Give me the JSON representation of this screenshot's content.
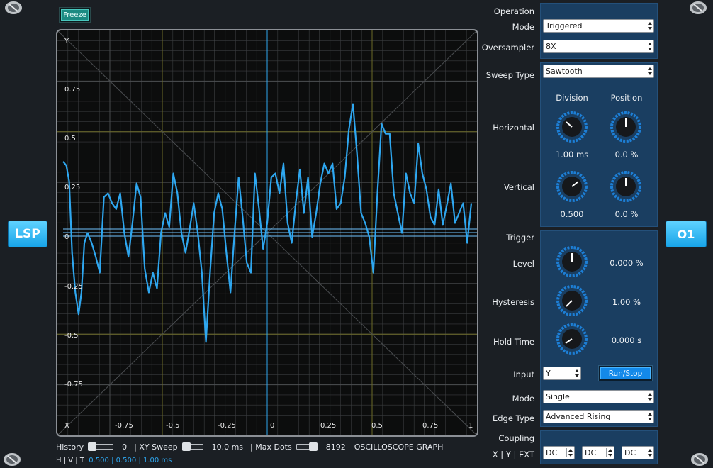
{
  "left_button": "LSP",
  "right_button": "O1",
  "freeze_label": "Freeze",
  "graph": {
    "y_axis_label": "Y",
    "x_axis_label": "X",
    "y_ticks": [
      "0.75",
      "0.5",
      "0.25",
      "0",
      "-0.25",
      "-0.5",
      "-0.75"
    ],
    "x_ticks": [
      "-0.75",
      "-0.5",
      "-0.25",
      "0",
      "0.25",
      "0.5",
      "0.75",
      "1"
    ],
    "colors": {
      "trace": "#2ea7f0",
      "grid": "#3a3d3f",
      "major_grid": "#6b6a26",
      "center": "#2ea7f0"
    }
  },
  "bottom": {
    "history_label": "History",
    "history_value": "0",
    "xy_sweep_label": "| XY Sweep",
    "xy_sweep_value": "10.0 ms",
    "max_dots_label": "| Max Dots",
    "max_dots_value": "8192",
    "graph_title": "OSCILLOSCOPE GRAPH",
    "hvt_label": "H | V | T",
    "hvt_values": "0.500 | 0.500 |  1.00 ms"
  },
  "operation": {
    "section_label": "Operation",
    "mode_label": "Mode",
    "mode_value": "Triggered",
    "oversampler_label": "Oversampler",
    "oversampler_value": "8X"
  },
  "sweep": {
    "sweep_type_label": "Sweep Type",
    "sweep_type_value": "Sawtooth",
    "division_label": "Division",
    "position_label": "Position",
    "horizontal_label": "Horizontal",
    "h_division_value": "1.00 ms",
    "h_position_value": "0.0 %",
    "vertical_label": "Vertical",
    "v_division_value": "0.500",
    "v_position_value": "0.0 %"
  },
  "trigger": {
    "section_label": "Trigger",
    "level_label": "Level",
    "level_value": "0.000 %",
    "hysteresis_label": "Hysteresis",
    "hysteresis_value": "1.00 %",
    "hold_time_label": "Hold Time",
    "hold_time_value": "0.000 s",
    "input_label": "Input",
    "input_value": "Y",
    "run_stop_label": "Run/Stop",
    "mode_label": "Mode",
    "mode_value": "Single",
    "edge_type_label": "Edge Type",
    "edge_type_value": "Advanced Rising"
  },
  "coupling": {
    "section_label": "Coupling",
    "channels_label": "X | Y | EXT",
    "x_value": "DC",
    "y_value": "DC",
    "ext_value": "DC"
  }
}
